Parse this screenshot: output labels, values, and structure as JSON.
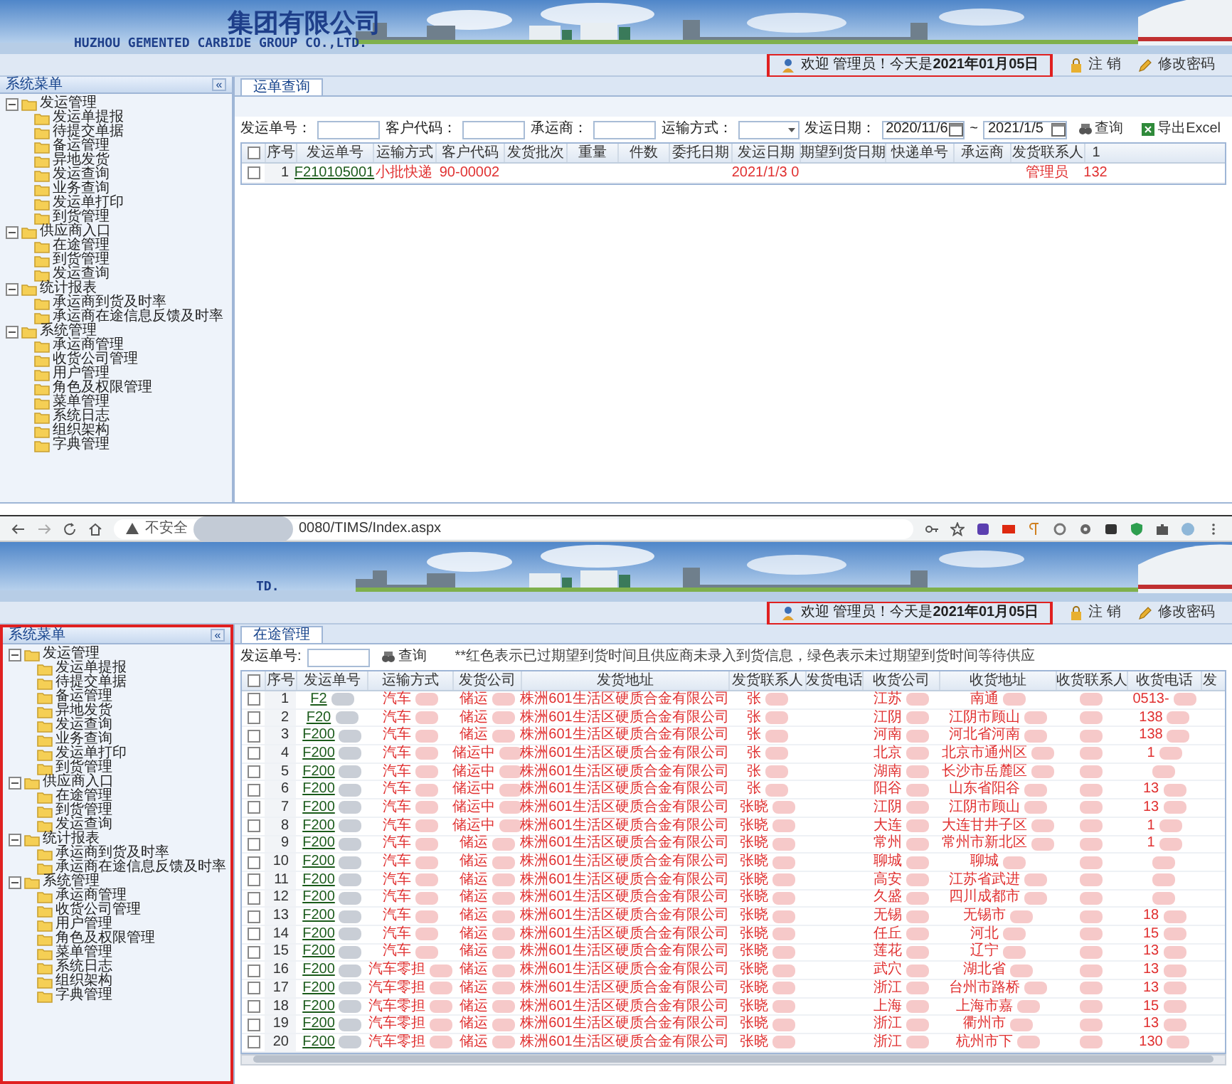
{
  "top_window": {
    "banner": {
      "company_name": "集团有限公司",
      "company_name_en": "HUZHOU GEMENTED CARBIDE GROUP CO.,LTD."
    },
    "toolbar": {
      "welcome": "欢迎 管理员！今天是**2021年01月05日**",
      "logout": "注 销",
      "change_password": "修改密码"
    },
    "sidebar": {
      "title": "系统菜单",
      "collapse": "«",
      "items": [
        {
          "label": "发运管理",
          "expanded": true,
          "children": [
            {
              "label": "发运单提报"
            },
            {
              "label": "待提交单据"
            },
            {
              "label": "备运管理"
            },
            {
              "label": "异地发货"
            },
            {
              "label": "发运查询"
            },
            {
              "label": "业务查询"
            },
            {
              "label": "发运单打印"
            },
            {
              "label": "到货管理"
            }
          ]
        },
        {
          "label": "供应商入口",
          "expanded": true,
          "children": [
            {
              "label": "在途管理"
            },
            {
              "label": "到货管理"
            },
            {
              "label": "发运查询"
            }
          ]
        },
        {
          "label": "统计报表",
          "expanded": true,
          "children": [
            {
              "label": "承运商到货及时率"
            },
            {
              "label": "承运商在途信息反馈及时率"
            }
          ]
        },
        {
          "label": "系统管理",
          "expanded": true,
          "children": [
            {
              "label": "承运商管理"
            },
            {
              "label": "收货公司管理"
            },
            {
              "label": "用户管理"
            },
            {
              "label": "角色及权限管理"
            },
            {
              "label": "菜单管理"
            },
            {
              "label": "系统日志"
            },
            {
              "label": "组织架构"
            },
            {
              "label": "字典管理"
            }
          ]
        }
      ]
    },
    "tabs": [
      {
        "label": "运单查询",
        "selected": true
      }
    ],
    "filters": [
      {
        "label": "发运单号：",
        "kind": "text"
      },
      {
        "label": "客户代码：",
        "kind": "text"
      },
      {
        "label": "承运商：",
        "kind": "text"
      },
      {
        "label": "运输方式：",
        "kind": "select"
      },
      {
        "label": "发运日期：",
        "kind": "date-range",
        "from": "2020/11/6",
        "separator": "~",
        "to": "2021/1/5"
      }
    ],
    "buttons": [
      {
        "label": "查询",
        "kind": "search"
      },
      {
        "label": "导出Excel",
        "kind": "excel"
      }
    ],
    "table": {
      "all_checked": false,
      "columns": [
        {
          "label": "序号",
          "kind": "number"
        },
        {
          "label": "发运单号",
          "kind": "link"
        },
        {
          "label": "运输方式",
          "kind": "text"
        },
        {
          "label": "客户代码",
          "kind": "text"
        },
        {
          "label": "发货批次",
          "kind": "text"
        },
        {
          "label": "重量",
          "kind": "text"
        },
        {
          "label": "件数",
          "kind": "text"
        },
        {
          "label": "委托日期",
          "kind": "text"
        },
        {
          "label": "发运日期",
          "kind": "text"
        },
        {
          "label": "期望到货日期",
          "kind": "text"
        },
        {
          "label": "快递单号",
          "kind": "text"
        },
        {
          "label": "承运商",
          "kind": "text"
        },
        {
          "label": "发货联系人",
          "kind": "text"
        },
        {
          "label": "1",
          "kind": "text"
        }
      ],
      "rows": [
        {
          "checked": false,
          "overdue": true,
          "seq": "1",
          "order_no": "F210105001",
          "transport": "小批快递",
          "customer_code": "90-00002",
          "ship_date": "2021/1/3 0",
          "contact": "管理员",
          "column_14": "132"
        }
      ]
    }
  },
  "bottom_window": {
    "browser": {
      "security": "不安全",
      "url": "0080/TIMS/Index.aspx"
    },
    "banner": {
      "company_name_en": "TD."
    },
    "toolbar": {
      "welcome": "欢迎 管理员！今天是**2021年01月05日**",
      "logout": "注 销",
      "change_password": "修改密码"
    },
    "sidebar": {
      "title": "系统菜单",
      "collapse": "«",
      "items": [
        {
          "label": "发运管理",
          "expanded": true,
          "children": [
            {
              "label": "发运单提报"
            },
            {
              "label": "待提交单据"
            },
            {
              "label": "备运管理"
            },
            {
              "label": "异地发货"
            },
            {
              "label": "发运查询"
            },
            {
              "label": "业务查询"
            },
            {
              "label": "发运单打印"
            },
            {
              "label": "到货管理"
            }
          ]
        },
        {
          "label": "供应商入口",
          "expanded": true,
          "children": [
            {
              "label": "在途管理"
            },
            {
              "label": "到货管理"
            },
            {
              "label": "发运查询"
            }
          ]
        },
        {
          "label": "统计报表",
          "expanded": true,
          "children": [
            {
              "label": "承运商到货及时率"
            },
            {
              "label": "承运商在途信息反馈及时率"
            }
          ]
        },
        {
          "label": "系统管理",
          "expanded": true,
          "children": [
            {
              "label": "承运商管理"
            },
            {
              "label": "收货公司管理"
            },
            {
              "label": "用户管理"
            },
            {
              "label": "角色及权限管理"
            },
            {
              "label": "菜单管理"
            },
            {
              "label": "系统日志"
            },
            {
              "label": "组织架构"
            },
            {
              "label": "字典管理"
            }
          ]
        }
      ]
    },
    "tabs": [
      {
        "label": "在途管理",
        "selected": true
      }
    ],
    "filters": [
      {
        "label": "发运单号:",
        "kind": "text"
      }
    ],
    "buttons": [
      {
        "label": "查询",
        "kind": "search"
      }
    ],
    "note": "**红色表示已过期望到货时间且供应商未录入到货信息，绿色表示未过期望到货时间等待供应",
    "table": {
      "all_checked": false,
      "columns": [
        {
          "label": "序号",
          "kind": "number"
        },
        {
          "label": "发运单号",
          "kind": "link",
          "redacted": true
        },
        {
          "label": "运输方式",
          "kind": "text",
          "redacted": true
        },
        {
          "label": "发货公司",
          "kind": "text",
          "redacted": true
        },
        {
          "label": "发货地址",
          "kind": "text"
        },
        {
          "label": "发货联系人",
          "kind": "text",
          "redacted": true
        },
        {
          "label": "发货电话",
          "kind": "text"
        },
        {
          "label": "收货公司",
          "kind": "text",
          "redacted": true
        },
        {
          "label": "收货地址",
          "kind": "text",
          "redacted": true
        },
        {
          "label": "收货联系人",
          "kind": "text",
          "redacted": true
        },
        {
          "label": "收货电话",
          "kind": "text",
          "redacted": true
        },
        {
          "label": "发",
          "kind": "text"
        }
      ],
      "rows": [
        {
          "checked": false,
          "overdue": true,
          "seq": "1",
          "order_no": "F2",
          "transport": "汽车",
          "ship_company": "储运",
          "ship_address": "株洲601生活区硬质合金有限公司",
          "ship_contact": "张",
          "recv_company": "江苏",
          "recv_address": "南通",
          "recv_phone": "0513-"
        },
        {
          "checked": false,
          "overdue": true,
          "seq": "2",
          "order_no": "F20",
          "transport": "汽车",
          "ship_company": "储运",
          "ship_address": "株洲601生活区硬质合金有限公司",
          "ship_contact": "张",
          "recv_company": "江阴",
          "recv_address": "江阴市顾山",
          "recv_phone": "138"
        },
        {
          "checked": false,
          "overdue": true,
          "seq": "3",
          "order_no": "F200",
          "transport": "汽车",
          "ship_company": "储运",
          "ship_address": "株洲601生活区硬质合金有限公司",
          "ship_contact": "张",
          "recv_company": "河南",
          "recv_address": "河北省河南",
          "recv_phone": "138"
        },
        {
          "checked": false,
          "overdue": true,
          "seq": "4",
          "order_no": "F200",
          "transport": "汽车",
          "ship_company": "储运中",
          "ship_address": "株洲601生活区硬质合金有限公司",
          "ship_contact": "张",
          "recv_company": "北京",
          "recv_address": "北京市通州区",
          "recv_phone": "1"
        },
        {
          "checked": false,
          "overdue": true,
          "seq": "5",
          "order_no": "F200",
          "transport": "汽车",
          "ship_company": "储运中",
          "ship_address": "株洲601生活区硬质合金有限公司",
          "ship_contact": "张",
          "recv_company": "湖南",
          "recv_address": "长沙市岳麓区"
        },
        {
          "checked": false,
          "overdue": true,
          "seq": "6",
          "order_no": "F200",
          "transport": "汽车",
          "ship_company": "储运中",
          "ship_address": "株洲601生活区硬质合金有限公司",
          "ship_contact": "张",
          "recv_company": "阳谷",
          "recv_address": "山东省阳谷",
          "recv_phone": "13"
        },
        {
          "checked": false,
          "overdue": true,
          "seq": "7",
          "order_no": "F200",
          "transport": "汽车",
          "ship_company": "储运中",
          "ship_address": "株洲601生活区硬质合金有限公司",
          "ship_contact": "张晓",
          "recv_company": "江阴",
          "recv_address": "江阴市顾山",
          "recv_phone": "13"
        },
        {
          "checked": false,
          "overdue": true,
          "seq": "8",
          "order_no": "F200",
          "transport": "汽车",
          "ship_company": "储运中",
          "ship_address": "株洲601生活区硬质合金有限公司",
          "ship_contact": "张晓",
          "recv_company": "大连",
          "recv_address": "大连甘井子区",
          "recv_phone": "1"
        },
        {
          "checked": false,
          "overdue": true,
          "seq": "9",
          "order_no": "F200",
          "transport": "汽车",
          "ship_company": "储运",
          "ship_address": "株洲601生活区硬质合金有限公司",
          "ship_contact": "张晓",
          "recv_company": "常州",
          "recv_address": "常州市新北区",
          "recv_phone": "1"
        },
        {
          "checked": false,
          "overdue": true,
          "seq": "10",
          "order_no": "F200",
          "transport": "汽车",
          "ship_company": "储运",
          "ship_address": "株洲601生活区硬质合金有限公司",
          "ship_contact": "张晓",
          "recv_company": "聊城",
          "recv_address": "聊城"
        },
        {
          "checked": false,
          "overdue": true,
          "seq": "11",
          "order_no": "F200",
          "transport": "汽车",
          "ship_company": "储运",
          "ship_address": "株洲601生活区硬质合金有限公司",
          "ship_contact": "张晓",
          "recv_company": "高安",
          "recv_address": "江苏省武进"
        },
        {
          "checked": false,
          "overdue": true,
          "seq": "12",
          "order_no": "F200",
          "transport": "汽车",
          "ship_company": "储运",
          "ship_address": "株洲601生活区硬质合金有限公司",
          "ship_contact": "张晓",
          "recv_company": "久盛",
          "recv_address": "四川成都市"
        },
        {
          "checked": false,
          "overdue": true,
          "seq": "13",
          "order_no": "F200",
          "transport": "汽车",
          "ship_company": "储运",
          "ship_address": "株洲601生活区硬质合金有限公司",
          "ship_contact": "张晓",
          "recv_company": "无锡",
          "recv_address": "无锡市",
          "recv_phone": "18"
        },
        {
          "checked": false,
          "overdue": true,
          "seq": "14",
          "order_no": "F200",
          "transport": "汽车",
          "ship_company": "储运",
          "ship_address": "株洲601生活区硬质合金有限公司",
          "ship_contact": "张晓",
          "recv_company": "任丘",
          "recv_address": "河北",
          "recv_phone": "15"
        },
        {
          "checked": false,
          "overdue": true,
          "seq": "15",
          "order_no": "F200",
          "transport": "汽车",
          "ship_company": "储运",
          "ship_address": "株洲601生活区硬质合金有限公司",
          "ship_contact": "张晓",
          "recv_company": "莲花",
          "recv_address": "辽宁",
          "recv_phone": "13"
        },
        {
          "checked": false,
          "overdue": true,
          "seq": "16",
          "order_no": "F200",
          "transport": "汽车零担",
          "ship_company": "储运",
          "ship_address": "株洲601生活区硬质合金有限公司",
          "ship_contact": "张晓",
          "recv_company": "武穴",
          "recv_address": "湖北省",
          "recv_phone": "13"
        },
        {
          "checked": false,
          "overdue": true,
          "seq": "17",
          "order_no": "F200",
          "transport": "汽车零担",
          "ship_company": "储运",
          "ship_address": "株洲601生活区硬质合金有限公司",
          "ship_contact": "张晓",
          "recv_company": "浙江",
          "recv_address": "台州市路桥",
          "recv_phone": "13"
        },
        {
          "checked": false,
          "overdue": true,
          "seq": "18",
          "order_no": "F200",
          "transport": "汽车零担",
          "ship_company": "储运",
          "ship_address": "株洲601生活区硬质合金有限公司",
          "ship_contact": "张晓",
          "recv_company": "上海",
          "recv_address": "上海市嘉",
          "recv_phone": "15"
        },
        {
          "checked": false,
          "overdue": true,
          "seq": "19",
          "order_no": "F200",
          "transport": "汽车零担",
          "ship_company": "储运",
          "ship_address": "株洲601生活区硬质合金有限公司",
          "ship_contact": "张晓",
          "recv_company": "浙江",
          "recv_address": "衢州市",
          "recv_phone": "13"
        },
        {
          "checked": false,
          "overdue": true,
          "seq": "20",
          "order_no": "F200",
          "transport": "汽车零担",
          "ship_company": "储运",
          "ship_address": "株洲601生活区硬质合金有限公司",
          "ship_contact": "张晓",
          "recv_company": "浙江",
          "recv_address": "杭州市下",
          "recv_phone": "130"
        }
      ]
    }
  }
}
